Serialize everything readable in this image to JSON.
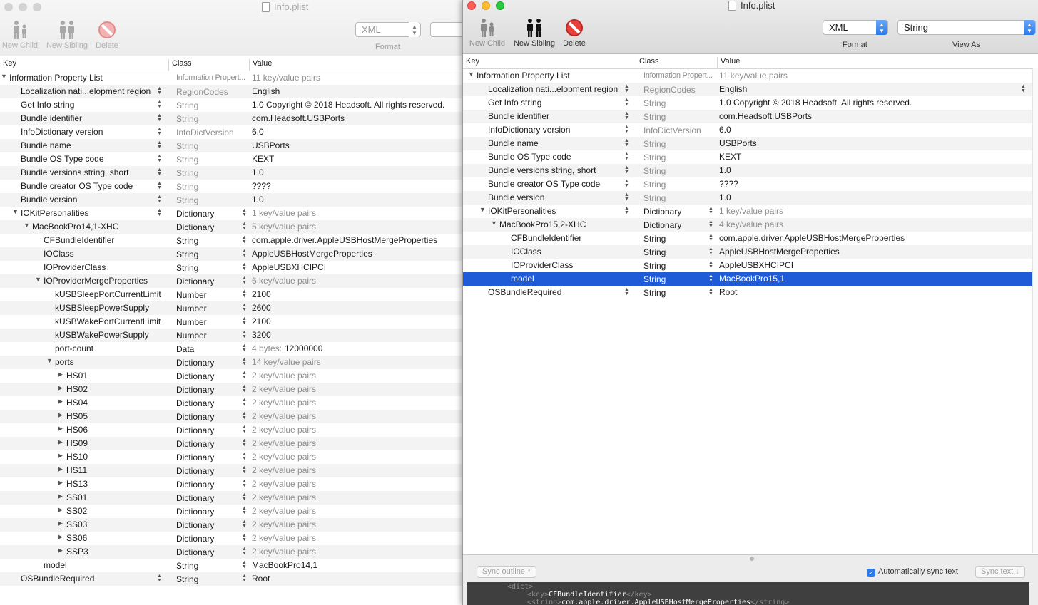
{
  "colors": {
    "selection": "#1f5bd7",
    "close": "#fd5f57",
    "minimize": "#fdbc2e",
    "zoom": "#28c840"
  },
  "left": {
    "title": "Info.plist",
    "buttons": {
      "new_child": "New Child",
      "new_sibling": "New Sibling",
      "delete": "Delete"
    },
    "format_value": "XML",
    "format_label": "Format",
    "headers": {
      "key": "Key",
      "class": "Class",
      "value": "Value"
    },
    "rows": [
      {
        "key": "Information Property List",
        "cls": "Information Propert...",
        "val": "11 key/value pairs"
      },
      {
        "key": "Localization nati...elopment region",
        "cls": "RegionCodes",
        "val": "English"
      },
      {
        "key": "Get Info string",
        "cls": "String",
        "val": "1.0 Copyright © 2018 Headsoft. All rights reserved."
      },
      {
        "key": "Bundle identifier",
        "cls": "String",
        "val": "com.Headsoft.USBPorts"
      },
      {
        "key": "InfoDictionary version",
        "cls": "InfoDictVersion",
        "val": "6.0"
      },
      {
        "key": "Bundle name",
        "cls": "String",
        "val": "USBPorts"
      },
      {
        "key": "Bundle OS Type code",
        "cls": "String",
        "val": "KEXT"
      },
      {
        "key": "Bundle versions string, short",
        "cls": "String",
        "val": "1.0"
      },
      {
        "key": "Bundle creator OS Type code",
        "cls": "String",
        "val": "????"
      },
      {
        "key": "Bundle version",
        "cls": "String",
        "val": "1.0"
      },
      {
        "key": "IOKitPersonalities",
        "cls": "Dictionary",
        "val": "1 key/value pairs"
      },
      {
        "key": "MacBookPro14,1-XHC",
        "cls": "Dictionary",
        "val": "5 key/value pairs"
      },
      {
        "key": "CFBundleIdentifier",
        "cls": "String",
        "val": "com.apple.driver.AppleUSBHostMergeProperties"
      },
      {
        "key": "IOClass",
        "cls": "String",
        "val": "AppleUSBHostMergeProperties"
      },
      {
        "key": "IOProviderClass",
        "cls": "String",
        "val": "AppleUSBXHCIPCI"
      },
      {
        "key": "IOProviderMergeProperties",
        "cls": "Dictionary",
        "val": "6 key/value pairs"
      },
      {
        "key": "kUSBSleepPortCurrentLimit",
        "cls": "Number",
        "val": "2100"
      },
      {
        "key": "kUSBSleepPowerSupply",
        "cls": "Number",
        "val": "2600"
      },
      {
        "key": "kUSBWakePortCurrentLimit",
        "cls": "Number",
        "val": "2100"
      },
      {
        "key": "kUSBWakePowerSupply",
        "cls": "Number",
        "val": "3200"
      },
      {
        "key": "port-count",
        "cls": "Data",
        "val": "4 bytes:",
        "val2": "12000000"
      },
      {
        "key": "ports",
        "cls": "Dictionary",
        "val": "14 key/value pairs"
      },
      {
        "key": "HS01",
        "cls": "Dictionary",
        "val": "2 key/value pairs"
      },
      {
        "key": "HS02",
        "cls": "Dictionary",
        "val": "2 key/value pairs"
      },
      {
        "key": "HS04",
        "cls": "Dictionary",
        "val": "2 key/value pairs"
      },
      {
        "key": "HS05",
        "cls": "Dictionary",
        "val": "2 key/value pairs"
      },
      {
        "key": "HS06",
        "cls": "Dictionary",
        "val": "2 key/value pairs"
      },
      {
        "key": "HS09",
        "cls": "Dictionary",
        "val": "2 key/value pairs"
      },
      {
        "key": "HS10",
        "cls": "Dictionary",
        "val": "2 key/value pairs"
      },
      {
        "key": "HS11",
        "cls": "Dictionary",
        "val": "2 key/value pairs"
      },
      {
        "key": "HS13",
        "cls": "Dictionary",
        "val": "2 key/value pairs"
      },
      {
        "key": "SS01",
        "cls": "Dictionary",
        "val": "2 key/value pairs"
      },
      {
        "key": "SS02",
        "cls": "Dictionary",
        "val": "2 key/value pairs"
      },
      {
        "key": "SS03",
        "cls": "Dictionary",
        "val": "2 key/value pairs"
      },
      {
        "key": "SS06",
        "cls": "Dictionary",
        "val": "2 key/value pairs"
      },
      {
        "key": "SSP3",
        "cls": "Dictionary",
        "val": "2 key/value pairs"
      },
      {
        "key": "model",
        "cls": "String",
        "val": "MacBookPro14,1"
      },
      {
        "key": "OSBundleRequired",
        "cls": "String",
        "val": "Root"
      }
    ]
  },
  "right": {
    "title": "Info.plist",
    "buttons": {
      "new_child": "New Child",
      "new_sibling": "New Sibling",
      "delete": "Delete"
    },
    "format_value": "XML",
    "format_label": "Format",
    "viewas_value": "String",
    "viewas_label": "View As",
    "headers": {
      "key": "Key",
      "class": "Class",
      "value": "Value"
    },
    "rows": [
      {
        "key": "Information Property List",
        "cls": "Information Propert...",
        "val": "11 key/value pairs"
      },
      {
        "key": "Localization nati...elopment region",
        "cls": "RegionCodes",
        "val": "English"
      },
      {
        "key": "Get Info string",
        "cls": "String",
        "val": "1.0 Copyright © 2018 Headsoft. All rights reserved."
      },
      {
        "key": "Bundle identifier",
        "cls": "String",
        "val": "com.Headsoft.USBPorts"
      },
      {
        "key": "InfoDictionary version",
        "cls": "InfoDictVersion",
        "val": "6.0"
      },
      {
        "key": "Bundle name",
        "cls": "String",
        "val": "USBPorts"
      },
      {
        "key": "Bundle OS Type code",
        "cls": "String",
        "val": "KEXT"
      },
      {
        "key": "Bundle versions string, short",
        "cls": "String",
        "val": "1.0"
      },
      {
        "key": "Bundle creator OS Type code",
        "cls": "String",
        "val": "????"
      },
      {
        "key": "Bundle version",
        "cls": "String",
        "val": "1.0"
      },
      {
        "key": "IOKitPersonalities",
        "cls": "Dictionary",
        "val": "1 key/value pairs"
      },
      {
        "key": "MacBookPro15,2-XHC",
        "cls": "Dictionary",
        "val": "4 key/value pairs"
      },
      {
        "key": "CFBundleIdentifier",
        "cls": "String",
        "val": "com.apple.driver.AppleUSBHostMergeProperties"
      },
      {
        "key": "IOClass",
        "cls": "String",
        "val": "AppleUSBHostMergeProperties"
      },
      {
        "key": "IOProviderClass",
        "cls": "String",
        "val": "AppleUSBXHCIPCI"
      },
      {
        "key": "model",
        "cls": "String",
        "val": "MacBookPro15,1"
      },
      {
        "key": "OSBundleRequired",
        "cls": "String",
        "val": "Root"
      }
    ],
    "sync_outline": "Sync outline ↑",
    "auto_sync": "Automatically sync text",
    "sync_text": "Sync text ↓",
    "code": {
      "open_dict": "<dict>",
      "key_open": "<key>",
      "key_text": "CFBundleIdentifier",
      "key_close": "</key>",
      "str_open": "<string>",
      "str_text": "com.apple.driver.AppleUSBHostMergeProperties",
      "str_close": "</string>"
    }
  }
}
